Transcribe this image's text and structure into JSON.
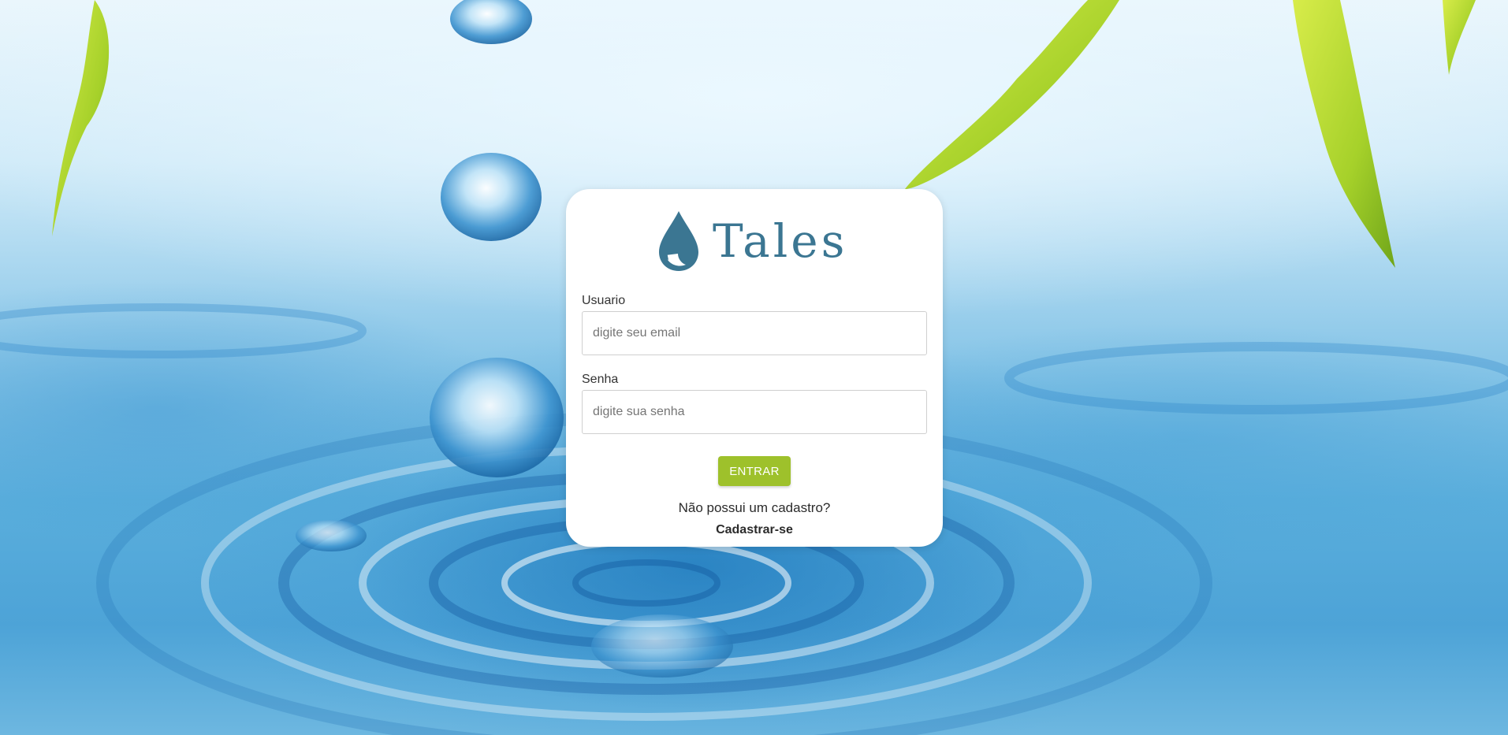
{
  "brand": {
    "name": "Tales",
    "color": "#3b7692"
  },
  "login_form": {
    "username_label": "Usuario",
    "username_placeholder": "digite seu email",
    "password_label": "Senha",
    "password_placeholder": "digite sua senha",
    "submit_label": "ENTRAR",
    "submit_color": "#9ec12b",
    "no_account_text": "Não possui um cadastro?",
    "register_link": "Cadastrar-se"
  },
  "background": {
    "description_icon": "water-ripple-background"
  }
}
